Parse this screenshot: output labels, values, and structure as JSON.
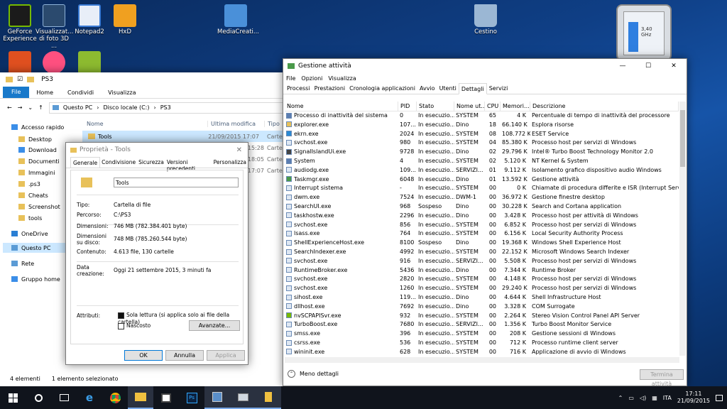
{
  "desktop": {
    "icons": [
      {
        "label": "GeForce Experience",
        "color": "#76b900"
      },
      {
        "label": "Visualizzat... di foto 3D ...",
        "color": "#2b4a6e"
      },
      {
        "label": "Notepad2",
        "color": "#3a7bd5"
      },
      {
        "label": "HxD",
        "color": "#f0a020"
      },
      {
        "label": "MediaCreati...",
        "color": "#4a90d9"
      },
      {
        "label": "Cestino",
        "color": "#9bb7d4"
      }
    ]
  },
  "gadget": {
    "freq": "3,40 GHz"
  },
  "explorer": {
    "breadcrumb": "PS3",
    "ribbon": {
      "file": "File",
      "home": "Home",
      "share": "Condividi",
      "view": "Visualizza"
    },
    "address": [
      "Questo PC",
      "Disco locale (C:)",
      "PS3"
    ],
    "columns": {
      "name": "Nome",
      "modified": "Ultima modifica",
      "type": "Tipo"
    },
    "nav": [
      {
        "label": "Accesso rapido",
        "icon": "star-icon",
        "depth": 0
      },
      {
        "label": "Desktop",
        "icon": "folder-icon",
        "depth": 1
      },
      {
        "label": "Download",
        "icon": "download-icon",
        "depth": 1
      },
      {
        "label": "Documenti",
        "icon": "folder-icon",
        "depth": 1
      },
      {
        "label": "Immagini",
        "icon": "folder-icon",
        "depth": 1
      },
      {
        "label": ".ps3",
        "icon": "folder-icon",
        "depth": 1
      },
      {
        "label": "Cheats",
        "icon": "folder-icon",
        "depth": 1
      },
      {
        "label": "Screenshot",
        "icon": "folder-icon",
        "depth": 1
      },
      {
        "label": "tools",
        "icon": "folder-icon",
        "depth": 1
      },
      {
        "label": "OneDrive",
        "icon": "cloud-icon",
        "depth": 0
      },
      {
        "label": "Questo PC",
        "icon": "pc-icon",
        "depth": 0
      },
      {
        "label": "Rete",
        "icon": "network-icon",
        "depth": 0
      },
      {
        "label": "Gruppo home",
        "icon": "homegroup-icon",
        "depth": 0
      }
    ],
    "files": [
      {
        "name": "Tools",
        "modified": "21/09/2015 17:07",
        "type": "Cartel"
      },
      {
        "name": "",
        "modified": "5 15:28",
        "type": "Cartel"
      },
      {
        "name": "",
        "modified": "5 18:05",
        "type": "Cartel"
      },
      {
        "name": "",
        "modified": "5 17:07",
        "type": "Cartel"
      }
    ],
    "status": {
      "count": "4 elementi",
      "selected": "1 elemento selezionato"
    }
  },
  "props": {
    "title": "Proprietà - Tools",
    "tabs": [
      "Generale",
      "Condivisione",
      "Sicurezza",
      "Versioni precedenti",
      "Personalizza"
    ],
    "name": "Tools",
    "rows": [
      {
        "label": "Tipo:",
        "value": "Cartella di file"
      },
      {
        "label": "Percorso:",
        "value": "C:\\PS3"
      },
      {
        "label": "Dimensioni:",
        "value": "746 MB (782.384.401 byte)"
      },
      {
        "label": "Dimensioni su disco:",
        "value": "748 MB (785.260.544 byte)"
      },
      {
        "label": "Contenuto:",
        "value": "4.613 file, 130 cartelle"
      },
      {
        "label": "Data creazione:",
        "value": "Oggi 21 settembre 2015, 3 minuti fa"
      }
    ],
    "attr_label": "Attributi:",
    "readonly": "Sola lettura (si applica solo ai file della cartella)",
    "hidden": "Nascosto",
    "advanced": "Avanzate...",
    "ok": "OK",
    "cancel": "Annulla",
    "apply": "Applica"
  },
  "taskmgr": {
    "title": "Gestione attività",
    "menu": [
      "File",
      "Opzioni",
      "Visualizza"
    ],
    "tabs": [
      "Processi",
      "Prestazioni",
      "Cronologia applicazioni",
      "Avvio",
      "Utenti",
      "Dettagli",
      "Servizi"
    ],
    "active_tab": "Dettagli",
    "columns": [
      "Nome",
      "PID",
      "Stato",
      "Nome ut...",
      "CPU",
      "Memori...",
      "Descrizione"
    ],
    "rows": [
      [
        "Processo di inattività del sistema",
        "0",
        "In esecuzio...",
        "SYSTEM",
        "65",
        "4 K",
        "Percentuale di tempo di inattività del processore"
      ],
      [
        "explorer.exe",
        "107...",
        "In esecuzio...",
        "Dino",
        "18",
        "66.140 K",
        "Esplora risorse"
      ],
      [
        "ekrn.exe",
        "2024",
        "In esecuzio...",
        "SYSTEM",
        "08",
        "108.772 K",
        "ESET Service"
      ],
      [
        "svchost.exe",
        "980",
        "In esecuzio...",
        "SYSTEM",
        "04",
        "85.380 K",
        "Processo host per servizi di Windows"
      ],
      [
        "SignalIslandUi.exe",
        "9728",
        "In esecuzio...",
        "Dino",
        "02",
        "29.796 K",
        "Intel® Turbo Boost Technology Monitor 2.0"
      ],
      [
        "System",
        "4",
        "In esecuzio...",
        "SYSTEM",
        "02",
        "5.120 K",
        "NT Kernel & System"
      ],
      [
        "audiodg.exe",
        "109...",
        "In esecuzio...",
        "SERVIZI...",
        "01",
        "9.112 K",
        "Isolamento grafico dispositivo audio Windows"
      ],
      [
        "Taskmgr.exe",
        "6048",
        "In esecuzio...",
        "Dino",
        "01",
        "13.592 K",
        "Gestione attività"
      ],
      [
        "Interrupt sistema",
        "-",
        "In esecuzio...",
        "SYSTEM",
        "00",
        "0 K",
        "Chiamate di procedura differite e ISR (Interrupt Service Ro"
      ],
      [
        "dwm.exe",
        "7524",
        "In esecuzio...",
        "DWM-1",
        "00",
        "36.972 K",
        "Gestione finestre desktop"
      ],
      [
        "SearchUI.exe",
        "968",
        "Sospeso",
        "Dino",
        "00",
        "30.228 K",
        "Search and Cortana application"
      ],
      [
        "taskhostw.exe",
        "2296",
        "In esecuzio...",
        "Dino",
        "00",
        "3.428 K",
        "Processo host per attività di Windows"
      ],
      [
        "svchost.exe",
        "856",
        "In esecuzio...",
        "SYSTEM",
        "00",
        "6.852 K",
        "Processo host per servizi di Windows"
      ],
      [
        "lsass.exe",
        "764",
        "In esecuzio...",
        "SYSTEM",
        "00",
        "6.156 K",
        "Local Security Authority Process"
      ],
      [
        "ShellExperienceHost.exe",
        "8100",
        "Sospeso",
        "Dino",
        "00",
        "19.368 K",
        "Windows Shell Experience Host"
      ],
      [
        "SearchIndexer.exe",
        "4992",
        "In esecuzio...",
        "SYSTEM",
        "00",
        "22.152 K",
        "Microsoft Windows Search Indexer"
      ],
      [
        "svchost.exe",
        "916",
        "In esecuzio...",
        "SERVIZI...",
        "00",
        "5.508 K",
        "Processo host per servizi di Windows"
      ],
      [
        "RuntimeBroker.exe",
        "5436",
        "In esecuzio...",
        "Dino",
        "00",
        "7.344 K",
        "Runtime Broker"
      ],
      [
        "svchost.exe",
        "2820",
        "In esecuzio...",
        "SYSTEM",
        "00",
        "4.148 K",
        "Processo host per servizi di Windows"
      ],
      [
        "svchost.exe",
        "1260",
        "In esecuzio...",
        "SYSTEM",
        "00",
        "29.240 K",
        "Processo host per servizi di Windows"
      ],
      [
        "sihost.exe",
        "119...",
        "In esecuzio...",
        "Dino",
        "00",
        "4.644 K",
        "Shell Infrastructure Host"
      ],
      [
        "dllhost.exe",
        "7692",
        "In esecuzio...",
        "Dino",
        "00",
        "3.328 K",
        "COM Surrogate"
      ],
      [
        "nvSCPAPISvr.exe",
        "932",
        "In esecuzio...",
        "SYSTEM",
        "00",
        "2.264 K",
        "Stereo Vision Control Panel API Server"
      ],
      [
        "TurboBoost.exe",
        "7680",
        "In esecuzio...",
        "SERVIZI...",
        "00",
        "1.356 K",
        "Turbo Boost Monitor Service"
      ],
      [
        "smss.exe",
        "396",
        "In esecuzio...",
        "SYSTEM",
        "00",
        "208 K",
        "Gestione sessioni di Windows"
      ],
      [
        "csrss.exe",
        "536",
        "In esecuzio...",
        "SYSTEM",
        "00",
        "712 K",
        "Processo runtime client server"
      ],
      [
        "wininit.exe",
        "628",
        "In esecuzio...",
        "SYSTEM",
        "00",
        "716 K",
        "Applicazione di avvio di Windows"
      ]
    ],
    "less_details": "Meno dettagli",
    "end_task": "Termina attività"
  },
  "tray": {
    "lang": "ITA",
    "time": "17:11",
    "date": "21/09/2015"
  }
}
